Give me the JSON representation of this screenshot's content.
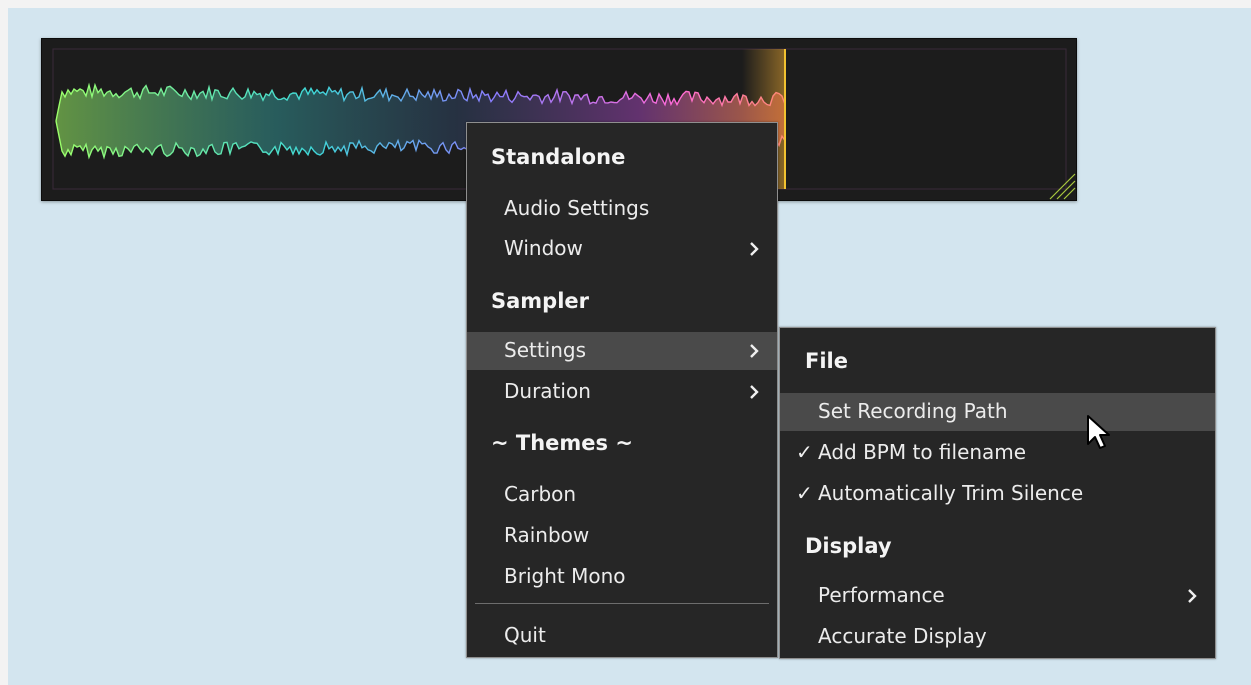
{
  "main_menu": {
    "standalone_heading": "Standalone",
    "audio_settings": "Audio Settings",
    "window": "Window",
    "sampler_heading": "Sampler",
    "settings": "Settings",
    "duration": "Duration",
    "themes_heading": "~ Themes ~",
    "theme_carbon": "Carbon",
    "theme_rainbow": "Rainbow",
    "theme_bright_mono": "Bright Mono",
    "quit": "Quit"
  },
  "settings_submenu": {
    "file_heading": "File",
    "set_recording_path": "Set Recording Path",
    "add_bpm": "Add BPM to filename",
    "add_bpm_checked": true,
    "trim_silence": "Automatically Trim Silence",
    "trim_silence_checked": true,
    "display_heading": "Display",
    "performance": "Performance",
    "accurate_display": "Accurate Display"
  },
  "icons": {
    "check": "✓",
    "submenu_arrow": "chevron-right-icon"
  },
  "colors": {
    "waveform_start": "#9cff6a",
    "waveform_mid1": "#3fd8d8",
    "waveform_mid2": "#8a7dff",
    "waveform_end": "#ff6ad8",
    "playhead": "#f2c230",
    "menu_bg": "#262626",
    "menu_highlight": "#4a4a4a",
    "background": "#d3e5ef"
  }
}
